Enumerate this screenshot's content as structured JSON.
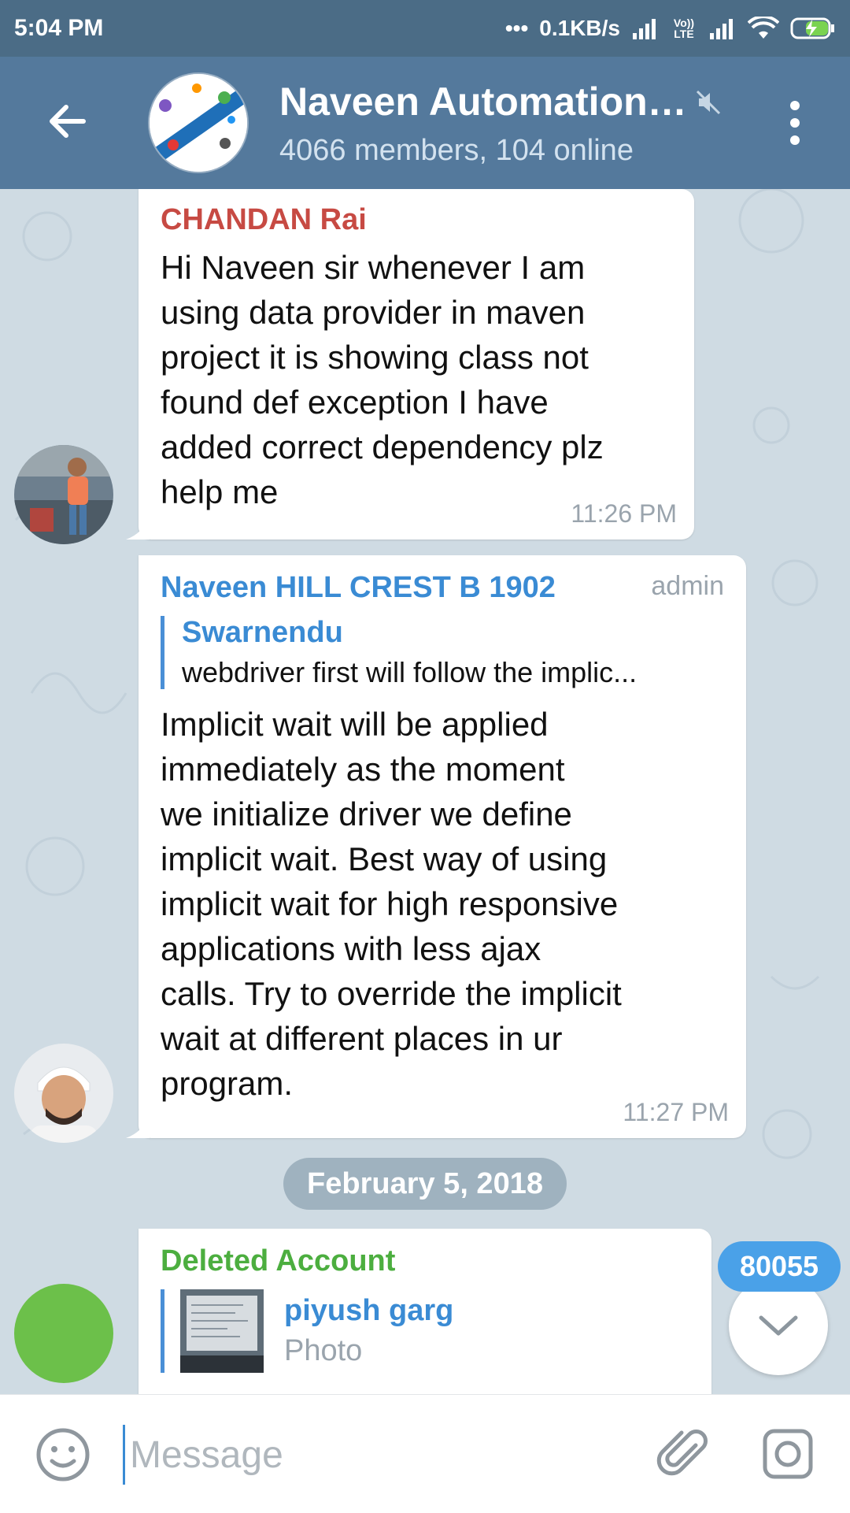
{
  "status_bar": {
    "time": "5:04 PM",
    "dots": "•••",
    "network_speed": "0.1KB/s",
    "volte": "Vo)) LTE"
  },
  "header": {
    "title": "Naveen Automation…",
    "subtitle": "4066 members, 104 online",
    "icons": [
      "back-arrow-icon",
      "mute-icon",
      "more-vert-icon"
    ]
  },
  "messages": [
    {
      "sender": "CHANDAN Rai",
      "sender_color": "#c74a43",
      "text": "Hi Naveen sir whenever I am\nusing data provider in maven\nproject it is showing class not\nfound def exception I have\nadded correct dependency plz\nhelp me",
      "time": "11:26 PM"
    },
    {
      "sender": "Naveen HILL CREST B 1902",
      "sender_color": "#3a8bd4",
      "role": "admin",
      "reply": {
        "name": "Swarnendu",
        "text": "webdriver first will follow the implic..."
      },
      "text": "Implicit wait will be applied\nimmediately as the moment\nwe initialize driver we define\nimplicit wait. Best way of using\nimplicit wait for high responsive\napplications with less ajax\ncalls. Try to override the implicit\nwait at different places in ur\nprogram.",
      "time": "11:27 PM"
    },
    {
      "sender": "Deleted Account",
      "sender_color": "#4cae3f",
      "reply": {
        "name": "piyush garg",
        "text": "Photo"
      }
    }
  ],
  "date_separator": "February 5, 2018",
  "unread_badge": "80055",
  "composer": {
    "placeholder": "Message",
    "icons": [
      "emoji-icon",
      "attach-icon",
      "camera-icon"
    ]
  },
  "colors": {
    "header": "#54799c",
    "status_bar": "#4b6c86",
    "chat_background": "#cfdbe3",
    "accent": "#3a8bd4"
  }
}
